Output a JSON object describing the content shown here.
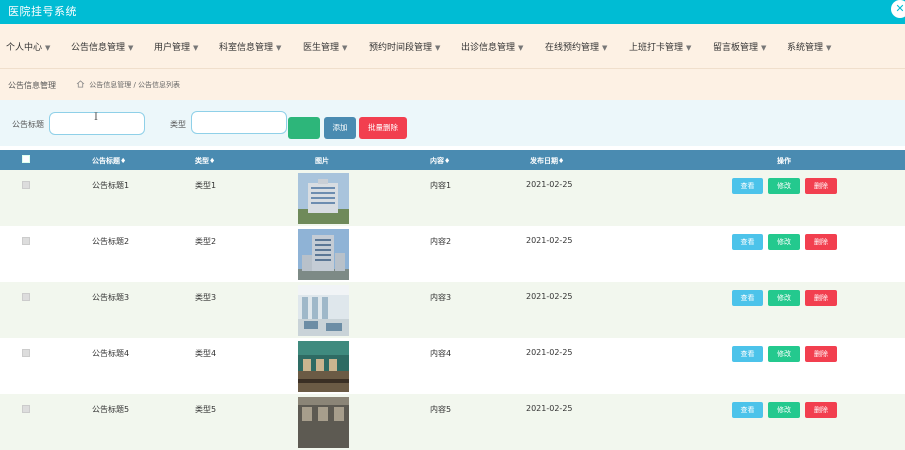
{
  "app": {
    "title": "医院挂号系统"
  },
  "nav": {
    "items": [
      {
        "label": "个人中心"
      },
      {
        "label": "公告信息管理"
      },
      {
        "label": "用户管理"
      },
      {
        "label": "科室信息管理"
      },
      {
        "label": "医生管理"
      },
      {
        "label": "预约时间段管理"
      },
      {
        "label": "出诊信息管理"
      },
      {
        "label": "在线预约管理"
      },
      {
        "label": "上班打卡管理"
      },
      {
        "label": "留言板管理"
      },
      {
        "label": "系统管理"
      }
    ]
  },
  "breadcrumb": {
    "page_title": "公告信息管理",
    "path": "公告信息管理 / 公告信息列表"
  },
  "search": {
    "title_label": "公告标题",
    "title_value": "",
    "type_label": "类型",
    "type_value": "",
    "search_button": "",
    "add_button": "添加",
    "batch_delete_button": "批量删除"
  },
  "table": {
    "headers": {
      "title": "公告标题♦",
      "type": "类型♦",
      "image": "图片",
      "content": "内容♦",
      "date": "发布日期♦",
      "actions": "操作"
    },
    "rows": [
      {
        "title": "公告标题1",
        "type": "类型1",
        "content": "内容1",
        "date": "2021-02-25"
      },
      {
        "title": "公告标题2",
        "type": "类型2",
        "content": "内容2",
        "date": "2021-02-25"
      },
      {
        "title": "公告标题3",
        "type": "类型3",
        "content": "内容3",
        "date": "2021-02-25"
      },
      {
        "title": "公告标题4",
        "type": "类型4",
        "content": "内容4",
        "date": "2021-02-25"
      },
      {
        "title": "公告标题5",
        "type": "类型5",
        "content": "内容5",
        "date": "2021-02-25"
      }
    ],
    "row_actions": {
      "view": "查看",
      "edit": "修改",
      "delete": "删除"
    }
  },
  "colors": {
    "header_bar": "#00bcd4",
    "nav_bg": "#fdf1e4",
    "table_header": "#4a8bb1",
    "view": "#4cc3ea",
    "edit": "#24c98e",
    "delete": "#f23f4f",
    "add": "#4a8bb1",
    "search": "#2db67a"
  }
}
